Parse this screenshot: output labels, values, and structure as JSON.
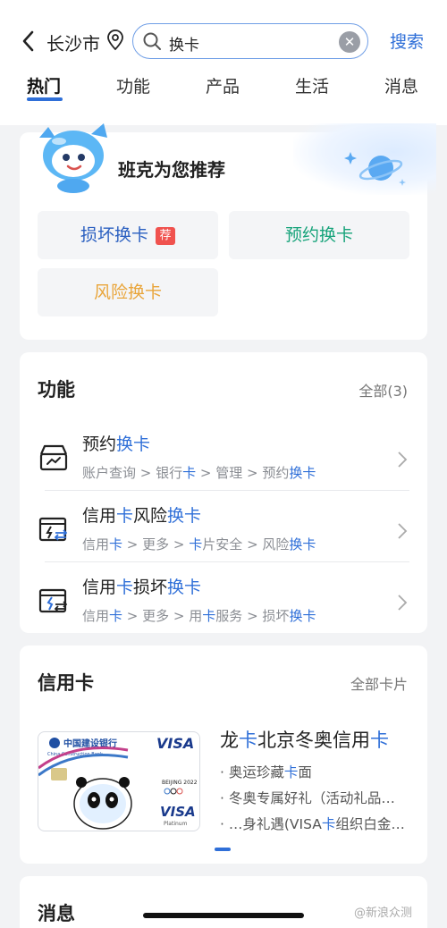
{
  "header": {
    "city": "长沙市",
    "search": {
      "query": "换卡"
    },
    "search_button": "搜索",
    "tabs": [
      {
        "label": "热门",
        "active": true
      },
      {
        "label": "功能",
        "active": false
      },
      {
        "label": "产品",
        "active": false
      },
      {
        "label": "生活",
        "active": false
      },
      {
        "label": "消息",
        "active": false
      }
    ]
  },
  "recommend": {
    "title": "班克为您推荐",
    "chips": [
      {
        "label": "损坏换卡",
        "badge": "荐"
      },
      {
        "label": "预约换卡"
      },
      {
        "label": "风险换卡"
      }
    ]
  },
  "functions": {
    "title": "功能",
    "more": "全部(3)",
    "rows": [
      {
        "title_plain": "预约",
        "title_hl": "换卡",
        "path": [
          "账户查询",
          "银行",
          "卡",
          "管理",
          "预约",
          "换卡"
        ]
      },
      {
        "title_a": "信用",
        "title_b": "卡",
        "title_c": "风险",
        "title_d": "换卡",
        "path": [
          "信用",
          "卡",
          "更多",
          "卡",
          "片安全",
          "风险",
          "换卡"
        ]
      },
      {
        "title_a": "信用",
        "title_b": "卡",
        "title_c": "损坏",
        "title_d": "换卡",
        "path": [
          "信用",
          "卡",
          "更多",
          "用",
          "卡",
          "服务",
          "损坏",
          "换卡"
        ]
      }
    ]
  },
  "credit": {
    "title": "信用卡",
    "more": "全部卡片",
    "card_name": {
      "a": "龙",
      "b": "卡",
      "c": "北京冬奥信用",
      "d": "卡"
    },
    "bullets": [
      {
        "a": "奥运珍藏",
        "b": "卡",
        "c": "面"
      },
      {
        "a": "冬奥专属好礼（活动礼品…"
      },
      {
        "a": "…身礼遇(VISA",
        "b": "卡",
        "c": "组织白金…"
      }
    ],
    "card_art": {
      "bank": "中国建设银行",
      "bank_en": "China Construction Bank",
      "brand": "VISA",
      "tier": "Platinum",
      "event": "BEIJING 2022"
    }
  },
  "messages": {
    "title": "消息"
  },
  "watermark": "@新浪众测",
  "colors": {
    "accent": "#2f6fd8",
    "badge": "#f0524e",
    "green": "#16a37a",
    "orange": "#e9a53a"
  }
}
